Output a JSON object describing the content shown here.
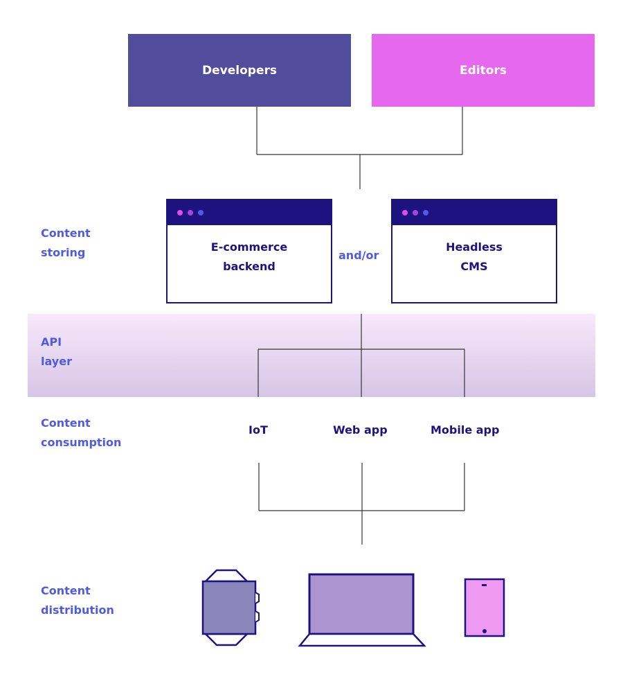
{
  "actors": [
    {
      "label": "Developers",
      "color": "#524c9c"
    },
    {
      "label": "Editors",
      "color": "#e568ee"
    }
  ],
  "layers": {
    "storing": "Content\nstoring",
    "api": "API\nlayer",
    "consumption": "Content\nconsumption",
    "distribution": "Content\ndistribution"
  },
  "storage": {
    "left": {
      "line1": "E-commerce",
      "line2": "backend"
    },
    "connector": "and/or",
    "right": {
      "line1": "Headless",
      "line2": "CMS"
    },
    "dot_colors": [
      "#e04ee8",
      "#a645e0",
      "#4f5ae6"
    ]
  },
  "apps": [
    "IoT",
    "Web app",
    "Mobile app"
  ],
  "devices": [
    {
      "name": "iot-device",
      "fill": "#8a86bb"
    },
    {
      "name": "laptop",
      "fill": "#ab94cf"
    },
    {
      "name": "tablet",
      "fill": "#ef9af2"
    }
  ],
  "colors": {
    "accent": "#4f5ae6",
    "dark": "#1c1280"
  }
}
